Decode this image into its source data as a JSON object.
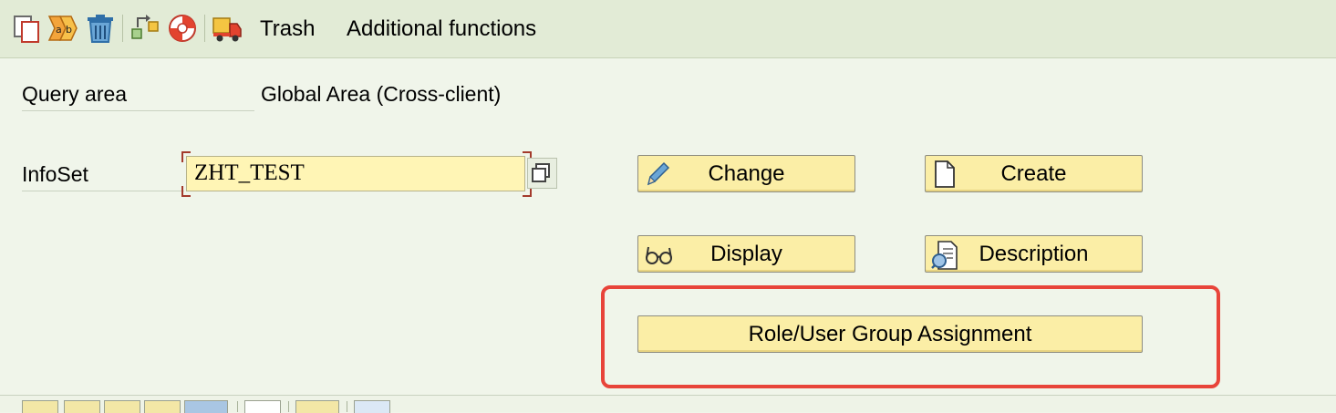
{
  "toolbar": {
    "icons": [
      "copy-icon",
      "rename-icon",
      "delete-icon",
      "transport-icon",
      "lifebuoy-icon",
      "truck-icon"
    ],
    "menu_items": [
      "Trash",
      "Additional functions"
    ]
  },
  "form": {
    "query_area_label": "Query area",
    "query_area_value": "Global Area (Cross-client)",
    "infoset_label": "InfoSet",
    "infoset_value": "ZHT_TEST"
  },
  "buttons": {
    "change": "Change",
    "create": "Create",
    "display": "Display",
    "description": "Description",
    "role_assignment": "Role/User Group Assignment"
  },
  "colors": {
    "background": "#f0f5ea",
    "toolbar": "#e2ebd6",
    "button": "#fbeea6",
    "input": "#fff5b5",
    "highlight": "#e8443a"
  }
}
